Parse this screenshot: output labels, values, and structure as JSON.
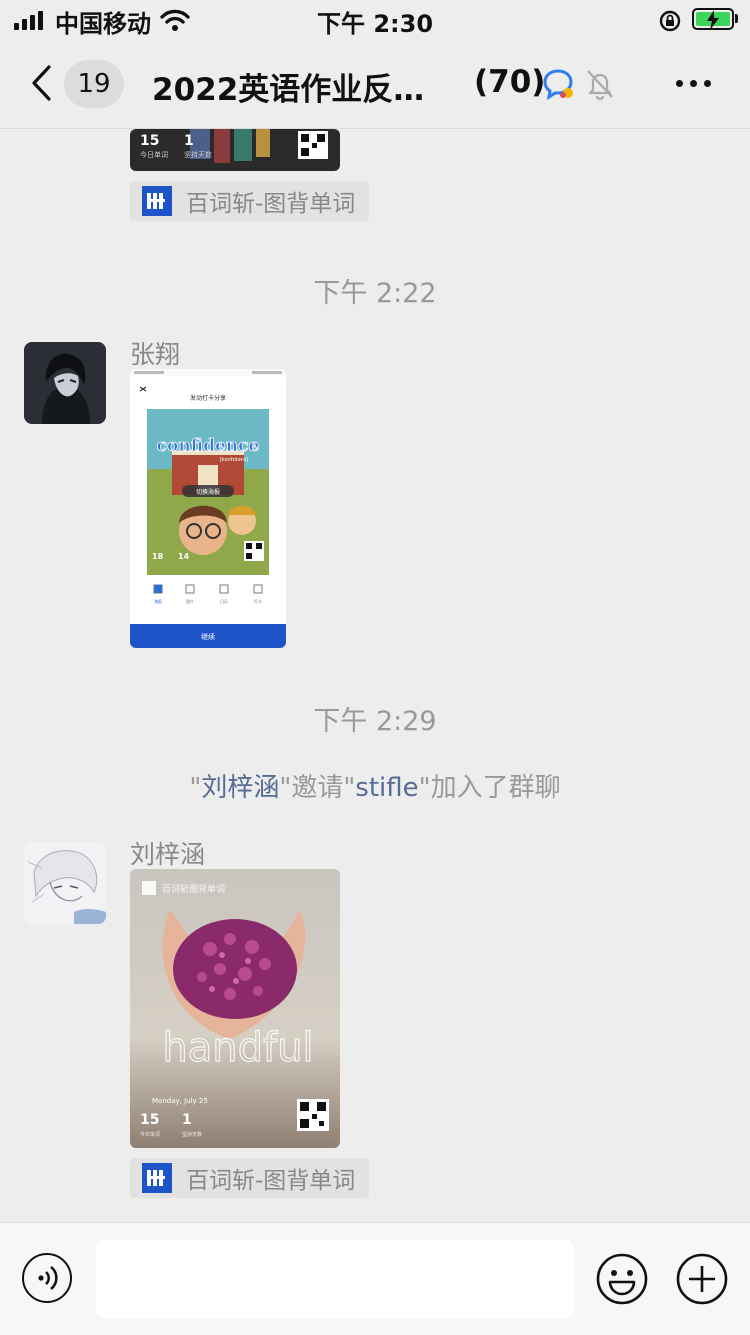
{
  "status_bar": {
    "carrier": "中国移动",
    "time": "下午 2:30"
  },
  "nav": {
    "back_badge": "19",
    "title": "2022英语作业反…",
    "member_count": "(70)"
  },
  "messages": {
    "top_app_tag": "百词斩-图背单词",
    "time_1": "下午 2:22",
    "sender_1": "张翔",
    "time_2": "下午 2:29",
    "system_notice": {
      "q1": "\"",
      "inviter": "刘梓涵",
      "mid": "\"邀请\"",
      "invitee": "stifle",
      "tail": "\"加入了群聊"
    },
    "sender_2": "刘梓涵",
    "bottom_app_tag": "百词斩-图背单词"
  },
  "cards": {
    "top": {
      "stat1": "15",
      "stat2": "1",
      "label1": "今日单词",
      "label2": "坚持天数"
    },
    "screenshot": {
      "header": "发动打卡分享",
      "word": "confidence",
      "phonetic": "[kɒnfɪdəns]",
      "btn": "切换海报",
      "stat1": "18",
      "stat2": "14",
      "tabs": [
        "海报",
        "图片",
        "日历",
        "打卡"
      ],
      "footer": "继续"
    },
    "handful": {
      "brand": "百词斩图背单词",
      "word": "handful",
      "date": "Monday, July 25",
      "stat1": "15",
      "stat2": "1",
      "label1": "今日单词",
      "label2": "坚持天数"
    }
  },
  "colors": {
    "background": "#ededed",
    "link_blue": "#576b95",
    "brand_blue": "#1d55c8",
    "battery_green": "#3dd45b"
  },
  "icons": [
    "signal-icon",
    "wifi-icon",
    "lock-rotation-icon",
    "battery-icon",
    "back-chevron-icon",
    "chat-bubble-icon",
    "mute-bell-icon",
    "more-icon",
    "voice-icon",
    "emoji-icon",
    "plus-icon"
  ]
}
